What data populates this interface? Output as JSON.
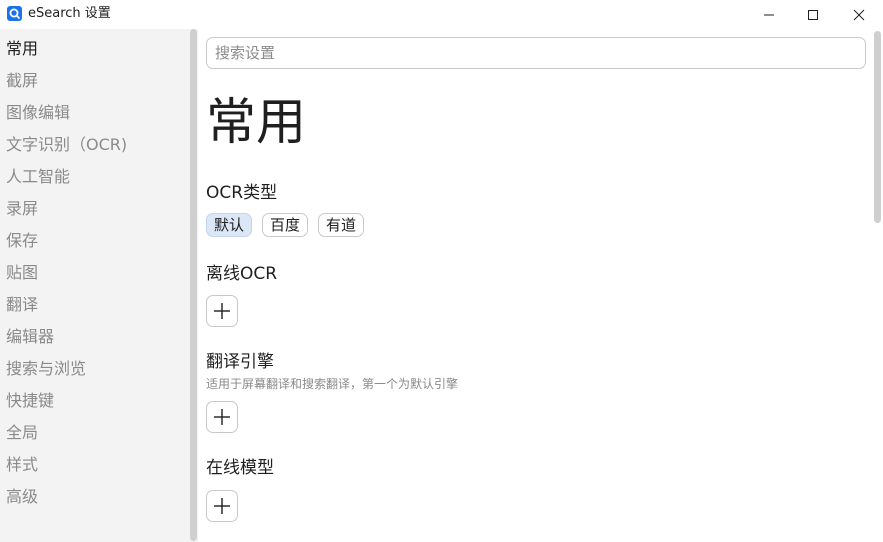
{
  "window": {
    "title": "eSearch 设置",
    "icon": "esearch-logo-icon",
    "accent_color": "#1a73e8"
  },
  "sidebar": {
    "items": [
      {
        "label": "常用",
        "active": true
      },
      {
        "label": "截屏",
        "active": false
      },
      {
        "label": "图像编辑",
        "active": false
      },
      {
        "label": "文字识别（OCR)",
        "active": false
      },
      {
        "label": "人工智能",
        "active": false
      },
      {
        "label": "录屏",
        "active": false
      },
      {
        "label": "保存",
        "active": false
      },
      {
        "label": "贴图",
        "active": false
      },
      {
        "label": "翻译",
        "active": false
      },
      {
        "label": "编辑器",
        "active": false
      },
      {
        "label": "搜索与浏览",
        "active": false
      },
      {
        "label": "快捷键",
        "active": false
      },
      {
        "label": "全局",
        "active": false
      },
      {
        "label": "样式",
        "active": false
      },
      {
        "label": "高级",
        "active": false
      }
    ]
  },
  "search": {
    "placeholder": "搜索设置",
    "value": ""
  },
  "main": {
    "page_title": "常用",
    "ocr_type": {
      "title": "OCR类型",
      "options": [
        "默认",
        "百度",
        "有道"
      ],
      "selected": "默认"
    },
    "offline_ocr": {
      "title": "离线OCR",
      "add_icon": "plus-icon"
    },
    "translate_engine": {
      "title": "翻译引擎",
      "description": "适用于屏幕翻译和搜索翻译，第一个为默认引擎",
      "add_icon": "plus-icon"
    },
    "online_model": {
      "title": "在线模型",
      "add_icon": "plus-icon"
    }
  }
}
